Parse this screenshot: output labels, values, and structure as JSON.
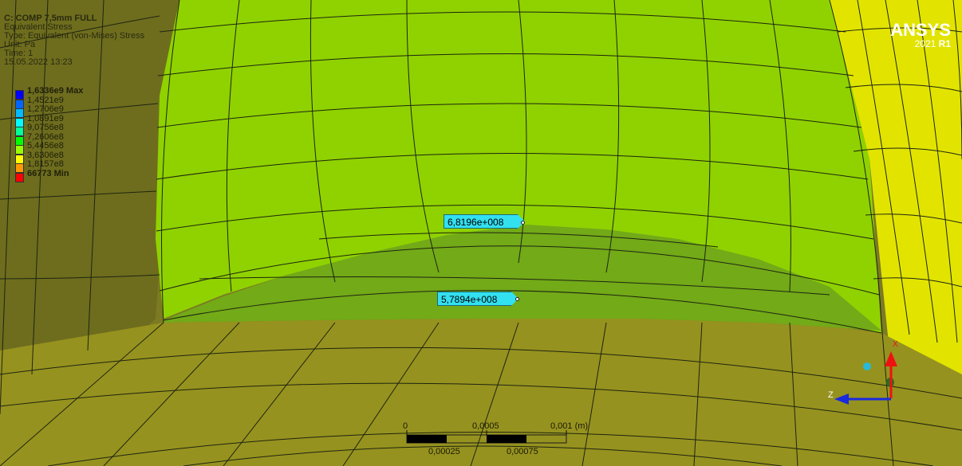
{
  "header": {
    "title": "C: COMP 7,5mm FULL",
    "result": "Equivalent Stress",
    "type": "Type: Equivalent (von-Mises) Stress",
    "unit": "Unit: Pa",
    "time": "Time: 1",
    "date": "15.05.2022 13:23"
  },
  "legend": {
    "entries": [
      {
        "label": "1,6336e9 Max",
        "color": "#0000ff",
        "bold": true
      },
      {
        "label": "1,4521e9",
        "color": "#0066ff"
      },
      {
        "label": "1,2706e9",
        "color": "#00bbff"
      },
      {
        "label": "1,0891e9",
        "color": "#00ffff"
      },
      {
        "label": "9,0756e8",
        "color": "#00ff99"
      },
      {
        "label": "7,2606e8",
        "color": "#00ff00"
      },
      {
        "label": "5,4456e8",
        "color": "#99ff00"
      },
      {
        "label": "3,6306e8",
        "color": "#ffff00"
      },
      {
        "label": "1,8157e8",
        "color": "#ff9900"
      },
      {
        "label": "66773 Min",
        "color": "#ff0000",
        "bold": true
      }
    ]
  },
  "logo": {
    "brand": "ANSYS",
    "version_year": "2021",
    "version_release": "R1"
  },
  "probes": [
    {
      "value": "6,8196e+008"
    },
    {
      "value": "5,7894e+008"
    }
  ],
  "scale_bar": {
    "top_labels": [
      "0",
      "0,0005",
      "0,001 (m)"
    ],
    "bottom_labels": [
      "0,00025",
      "0,00075"
    ]
  },
  "triad": {
    "axis_z": "Z",
    "axis_x": "X"
  },
  "colors": {
    "front_face": "#8fd200",
    "right_face": "#e2e400",
    "floor": "#96921f",
    "left_wall": "#7c7a23",
    "mesh": "#1e2410",
    "probe_bg": "#33e0f0"
  }
}
